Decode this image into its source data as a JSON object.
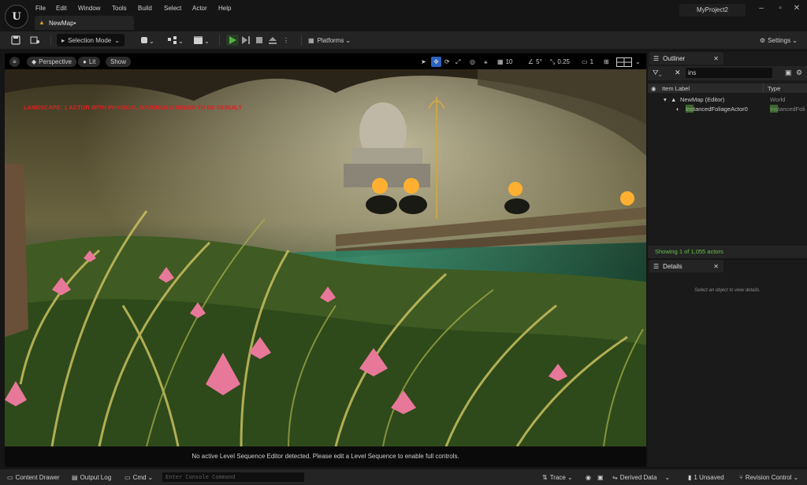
{
  "menu": {
    "items": [
      "File",
      "Edit",
      "Window",
      "Tools",
      "Build",
      "Select",
      "Actor",
      "Help"
    ]
  },
  "level_tab": {
    "label": "NewMap•"
  },
  "project": {
    "name": "MyProject2"
  },
  "toolbar": {
    "selection_mode": "Selection Mode",
    "platforms": "Platforms",
    "settings": "Settings"
  },
  "viewport": {
    "perspective": "Perspective",
    "lit": "Lit",
    "show": "Show",
    "grid_size": "10",
    "rotation_snap": "5°",
    "scale_snap": "0.25",
    "camera_speed": "1",
    "warning": "LANDSCAPE: 1 ACTOR WITH PHYSICAL MATERIALS NEEDS TO BE REBUILT",
    "sequence_msg": "No active Level Sequence Editor detected. Please edit a Level Sequence to enable full controls."
  },
  "outliner": {
    "tab": "Outliner",
    "search_value": "ins",
    "col_label": "Item Label",
    "col_type": "Type",
    "rows": [
      {
        "label": "NewMap (Editor)",
        "type": "World"
      },
      {
        "label": "InstancedFoliageActor0",
        "type": "InstancedFoli"
      }
    ],
    "status": "Showing 1 of 1,055 actors"
  },
  "details": {
    "tab": "Details",
    "hint": "Select an object to view details."
  },
  "statusbar": {
    "content_drawer": "Content Drawer",
    "output_log": "Output Log",
    "cmd": "Cmd",
    "console_placeholder": "Enter Console Command",
    "trace": "Trace",
    "derived_data": "Derived Data",
    "unsaved": "1 Unsaved",
    "revision_control": "Revision Control"
  },
  "colors": {
    "accent_green": "#66c04a",
    "warning_red": "#e02020",
    "play_green": "#4fb43a"
  }
}
